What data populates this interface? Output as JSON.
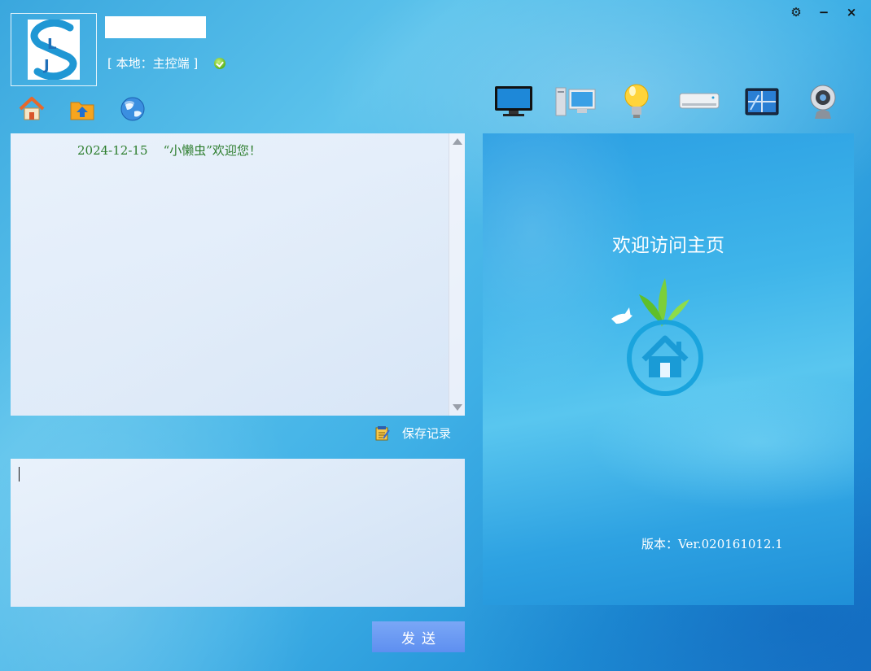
{
  "header": {
    "username": "",
    "local_status": "[ 本地：主控端 ]"
  },
  "window_controls": {
    "settings_glyph": "⚙",
    "minimize_glyph": "−",
    "close_glyph": "×"
  },
  "nav": {
    "icons": [
      "home-icon",
      "upload-folder-icon",
      "globe-icon"
    ]
  },
  "devices": {
    "icons": [
      "monitor-icon",
      "computer-icon",
      "light-bulb-icon",
      "air-conditioner-icon",
      "curtain-window-icon",
      "webcam-icon"
    ]
  },
  "chat": {
    "date": "2024-12-15",
    "welcome": "“小懒虫”欢迎您！"
  },
  "save_record": {
    "label": "保存记录"
  },
  "message_input": {
    "value": ""
  },
  "send_button": {
    "label": "发送"
  },
  "home_panel": {
    "title": "欢迎访问主页",
    "version": "版本：Ver.020161012.1"
  },
  "colors": {
    "accent_blue": "#2a9fd8",
    "send_button": "#6c9bf2",
    "chat_text_green": "#2c7d2c",
    "ok_green": "#6dbb1f"
  }
}
